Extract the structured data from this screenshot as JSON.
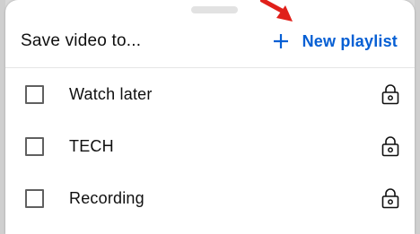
{
  "dialog": {
    "title": "Save video to...",
    "new_playlist_label": "New playlist",
    "accent_color": "#065fd4"
  },
  "playlists": [
    {
      "label": "Watch later",
      "checked": false,
      "privacy_icon": "lock-icon"
    },
    {
      "label": "TECH",
      "checked": false,
      "privacy_icon": "lock-icon"
    },
    {
      "label": "Recording",
      "checked": false,
      "privacy_icon": "lock-icon"
    }
  ],
  "annotation": {
    "arrow_color": "#e0201a"
  }
}
